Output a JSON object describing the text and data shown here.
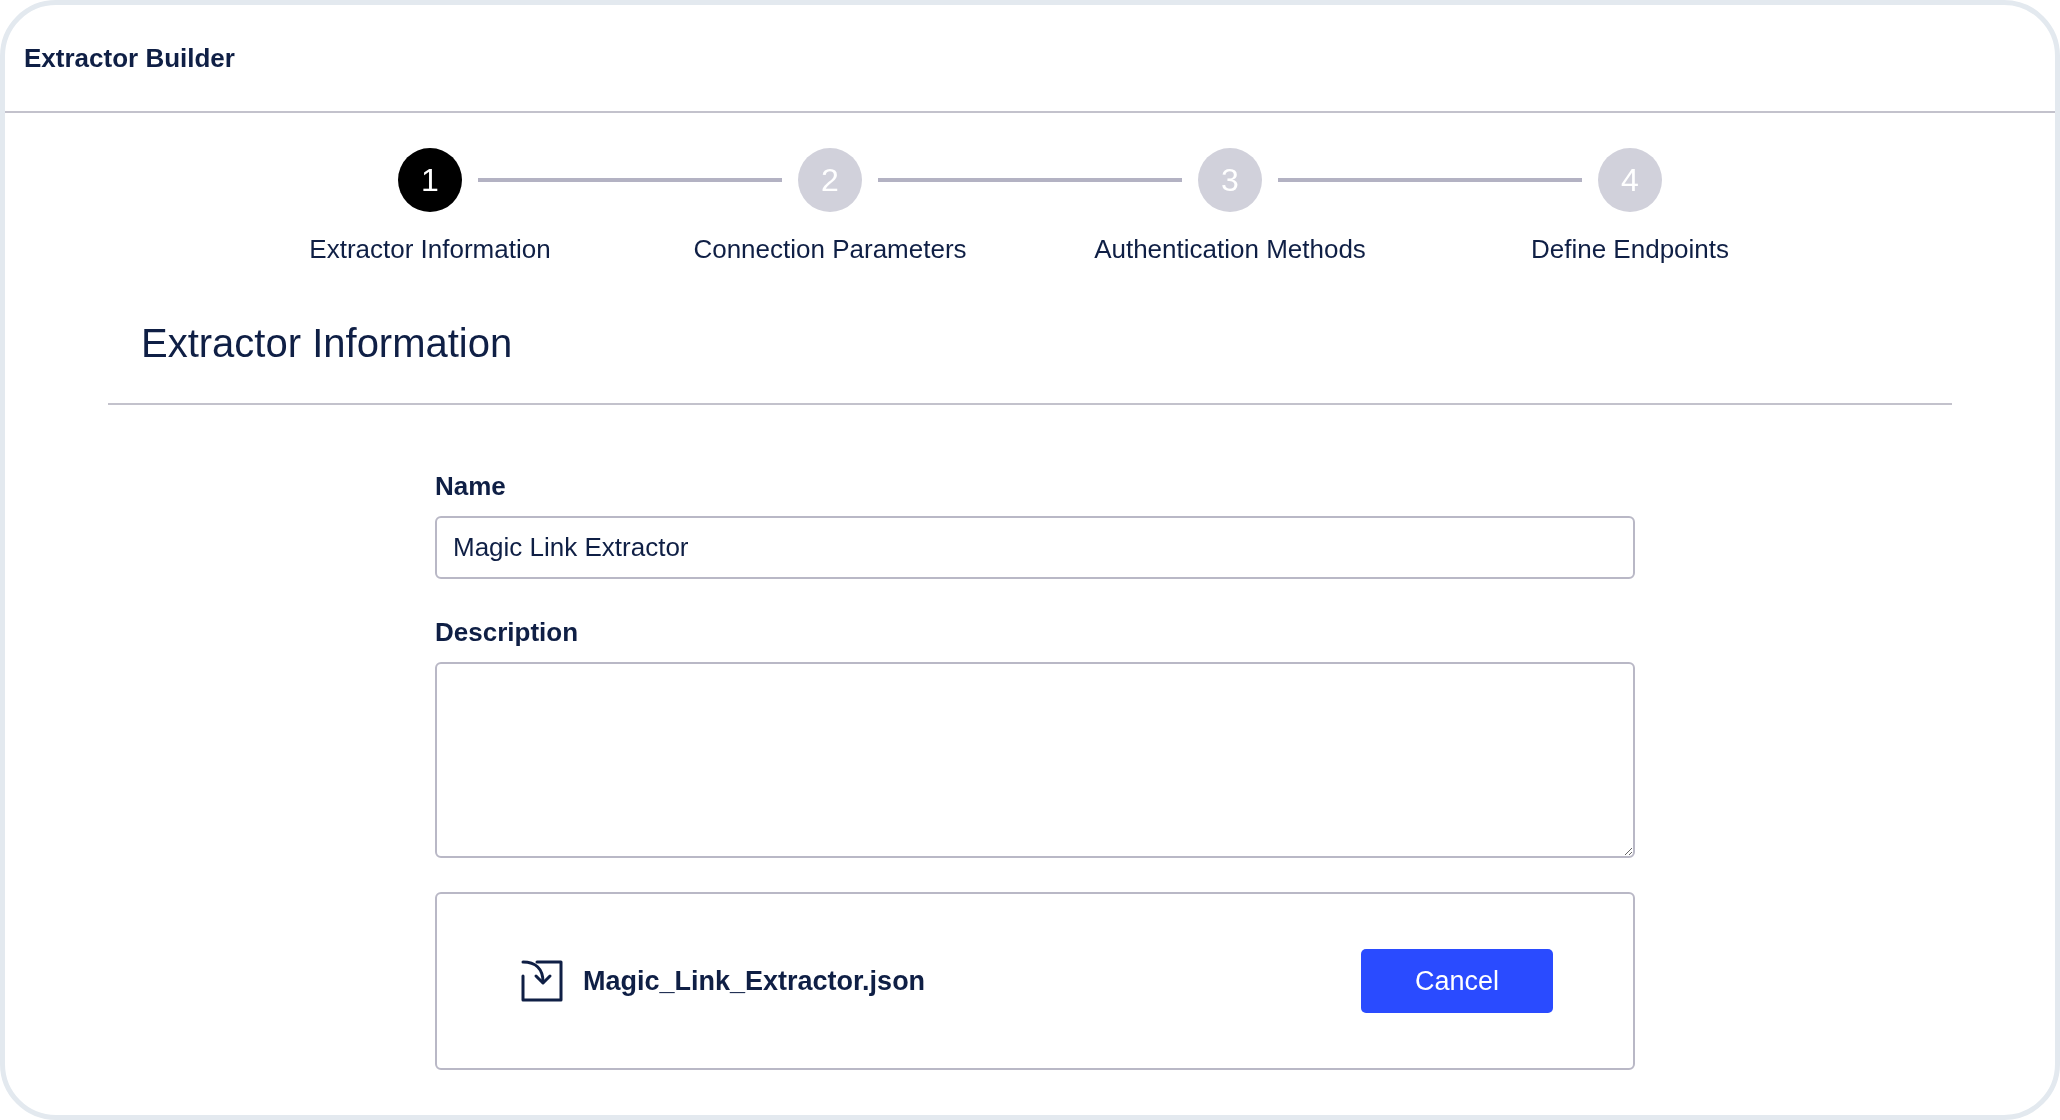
{
  "window": {
    "title": "Extractor Builder"
  },
  "steps": [
    {
      "number": "1",
      "label": "Extractor Information",
      "selected": true
    },
    {
      "number": "2",
      "label": "Connection Parameters",
      "selected": false
    },
    {
      "number": "3",
      "label": "Authentication Methods",
      "selected": false
    },
    {
      "number": "4",
      "label": "Define Endpoints",
      "selected": false
    }
  ],
  "section_title": "Extractor Information",
  "form": {
    "name": {
      "label": "Name",
      "value": "Magic Link Extractor"
    },
    "description": {
      "label": "Description"
    }
  },
  "file": {
    "name": "Magic_Link_Extractor.json",
    "button": "Cancel"
  }
}
